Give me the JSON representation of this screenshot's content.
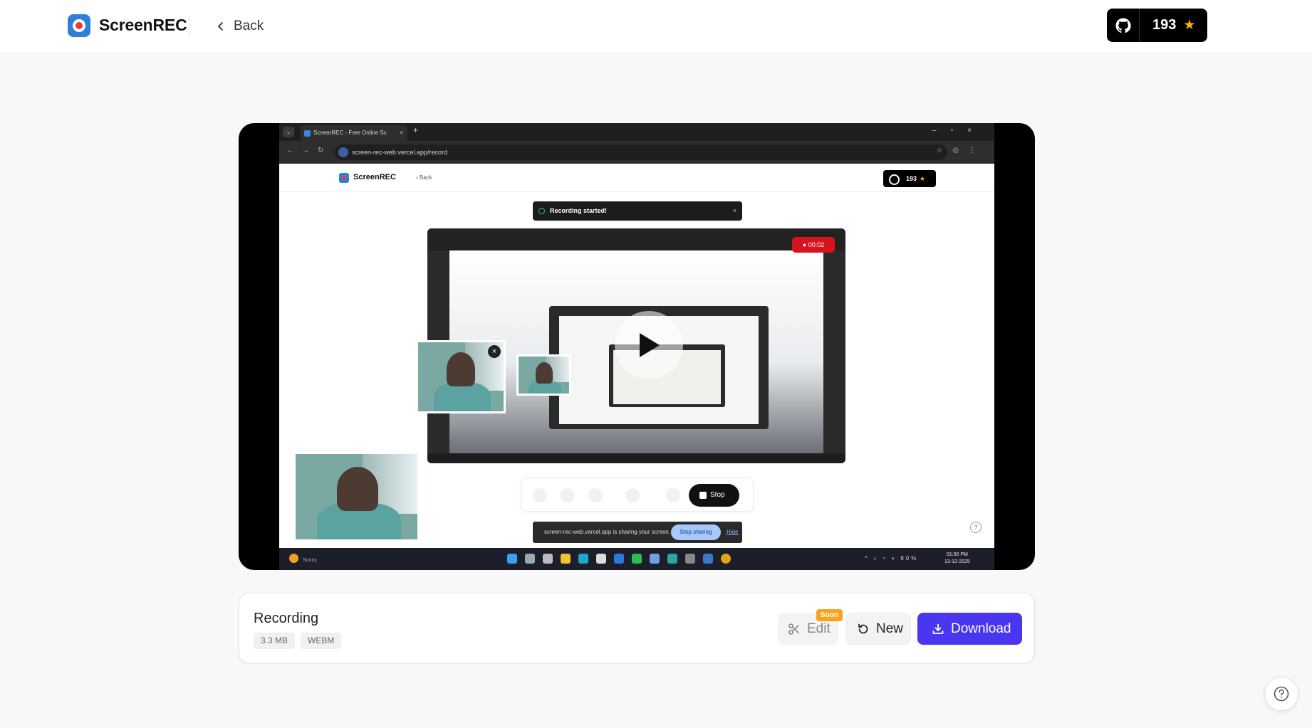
{
  "header": {
    "brand": "ScreenREC",
    "back_label": "Back",
    "github": {
      "stars": "193",
      "star_glyph": "★"
    }
  },
  "video": {
    "browser": {
      "tab_title": "ScreenREC - Free Online Sc",
      "url": "screen-rec-web.vercel.app/record"
    },
    "inner_app": {
      "brand": "ScreenREC",
      "back_label": "Back",
      "stars": "193"
    },
    "toast": "Recording started!",
    "rec_timer": "00:02",
    "controls": {
      "stop_label": "Stop"
    },
    "share_bar": {
      "text": "screen-rec-web.vercel.app is sharing your screen.",
      "stop_sharing": "Stop sharing",
      "hide": "Hide"
    },
    "taskbar": {
      "weather": "Sunny",
      "battery": "80%",
      "time": "01:00 PM",
      "date": "13-12-2025"
    }
  },
  "recording": {
    "title": "Recording",
    "size": "3.3 MB",
    "format": "WEBM",
    "actions": {
      "edit_label": "Edit",
      "soon_badge": "Soon",
      "new_label": "New",
      "download_label": "Download"
    }
  },
  "colors": {
    "accent": "#4a35f0",
    "soon": "#f7a41c",
    "rec_red": "#d7141d"
  }
}
